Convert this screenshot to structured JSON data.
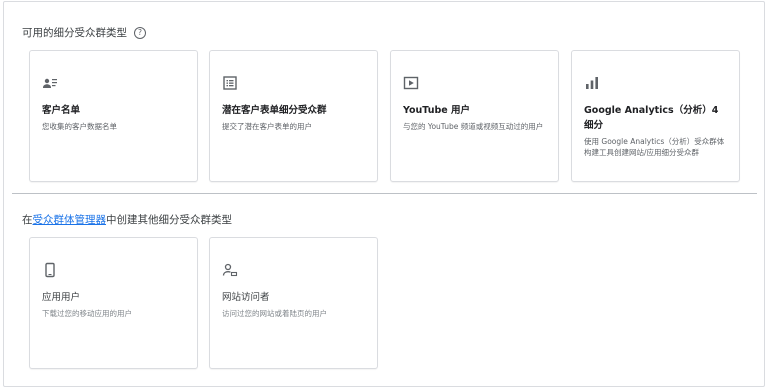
{
  "available_section": {
    "title": "可用的细分受众群类型",
    "help_icon": "help-circle-icon"
  },
  "cards": [
    {
      "icon": "customer-list-icon",
      "title": "客户名单",
      "description": "您收集的客户数据名单"
    },
    {
      "icon": "lead-form-icon",
      "title": "潜在客户表单细分受众群",
      "description": "提交了潜在客户表单的用户"
    },
    {
      "icon": "youtube-play-icon",
      "title": "YouTube 用户",
      "description": "与您的 YouTube 频道或视频互动过的用户"
    },
    {
      "icon": "analytics-bar-chart-icon",
      "title": "Google Analytics（分析）4 细分",
      "description": "使用 Google Analytics（分析）受众群体构建工具创建网站/应用细分受众群"
    }
  ],
  "other_section": {
    "prefix": "在",
    "link_text": "受众群体管理器",
    "suffix": "中创建其他细分受众群类型"
  },
  "other_cards": [
    {
      "icon": "mobile-phone-icon",
      "title": "应用用户",
      "description": "下载过您的移动应用的用户"
    },
    {
      "icon": "website-visitor-icon",
      "title": "网站访问者",
      "description": "访问过您的网站或着陆页的用户"
    }
  ],
  "colors": {
    "link": "#1a73e8",
    "border": "#dadce0",
    "icon": "#5f6368"
  }
}
